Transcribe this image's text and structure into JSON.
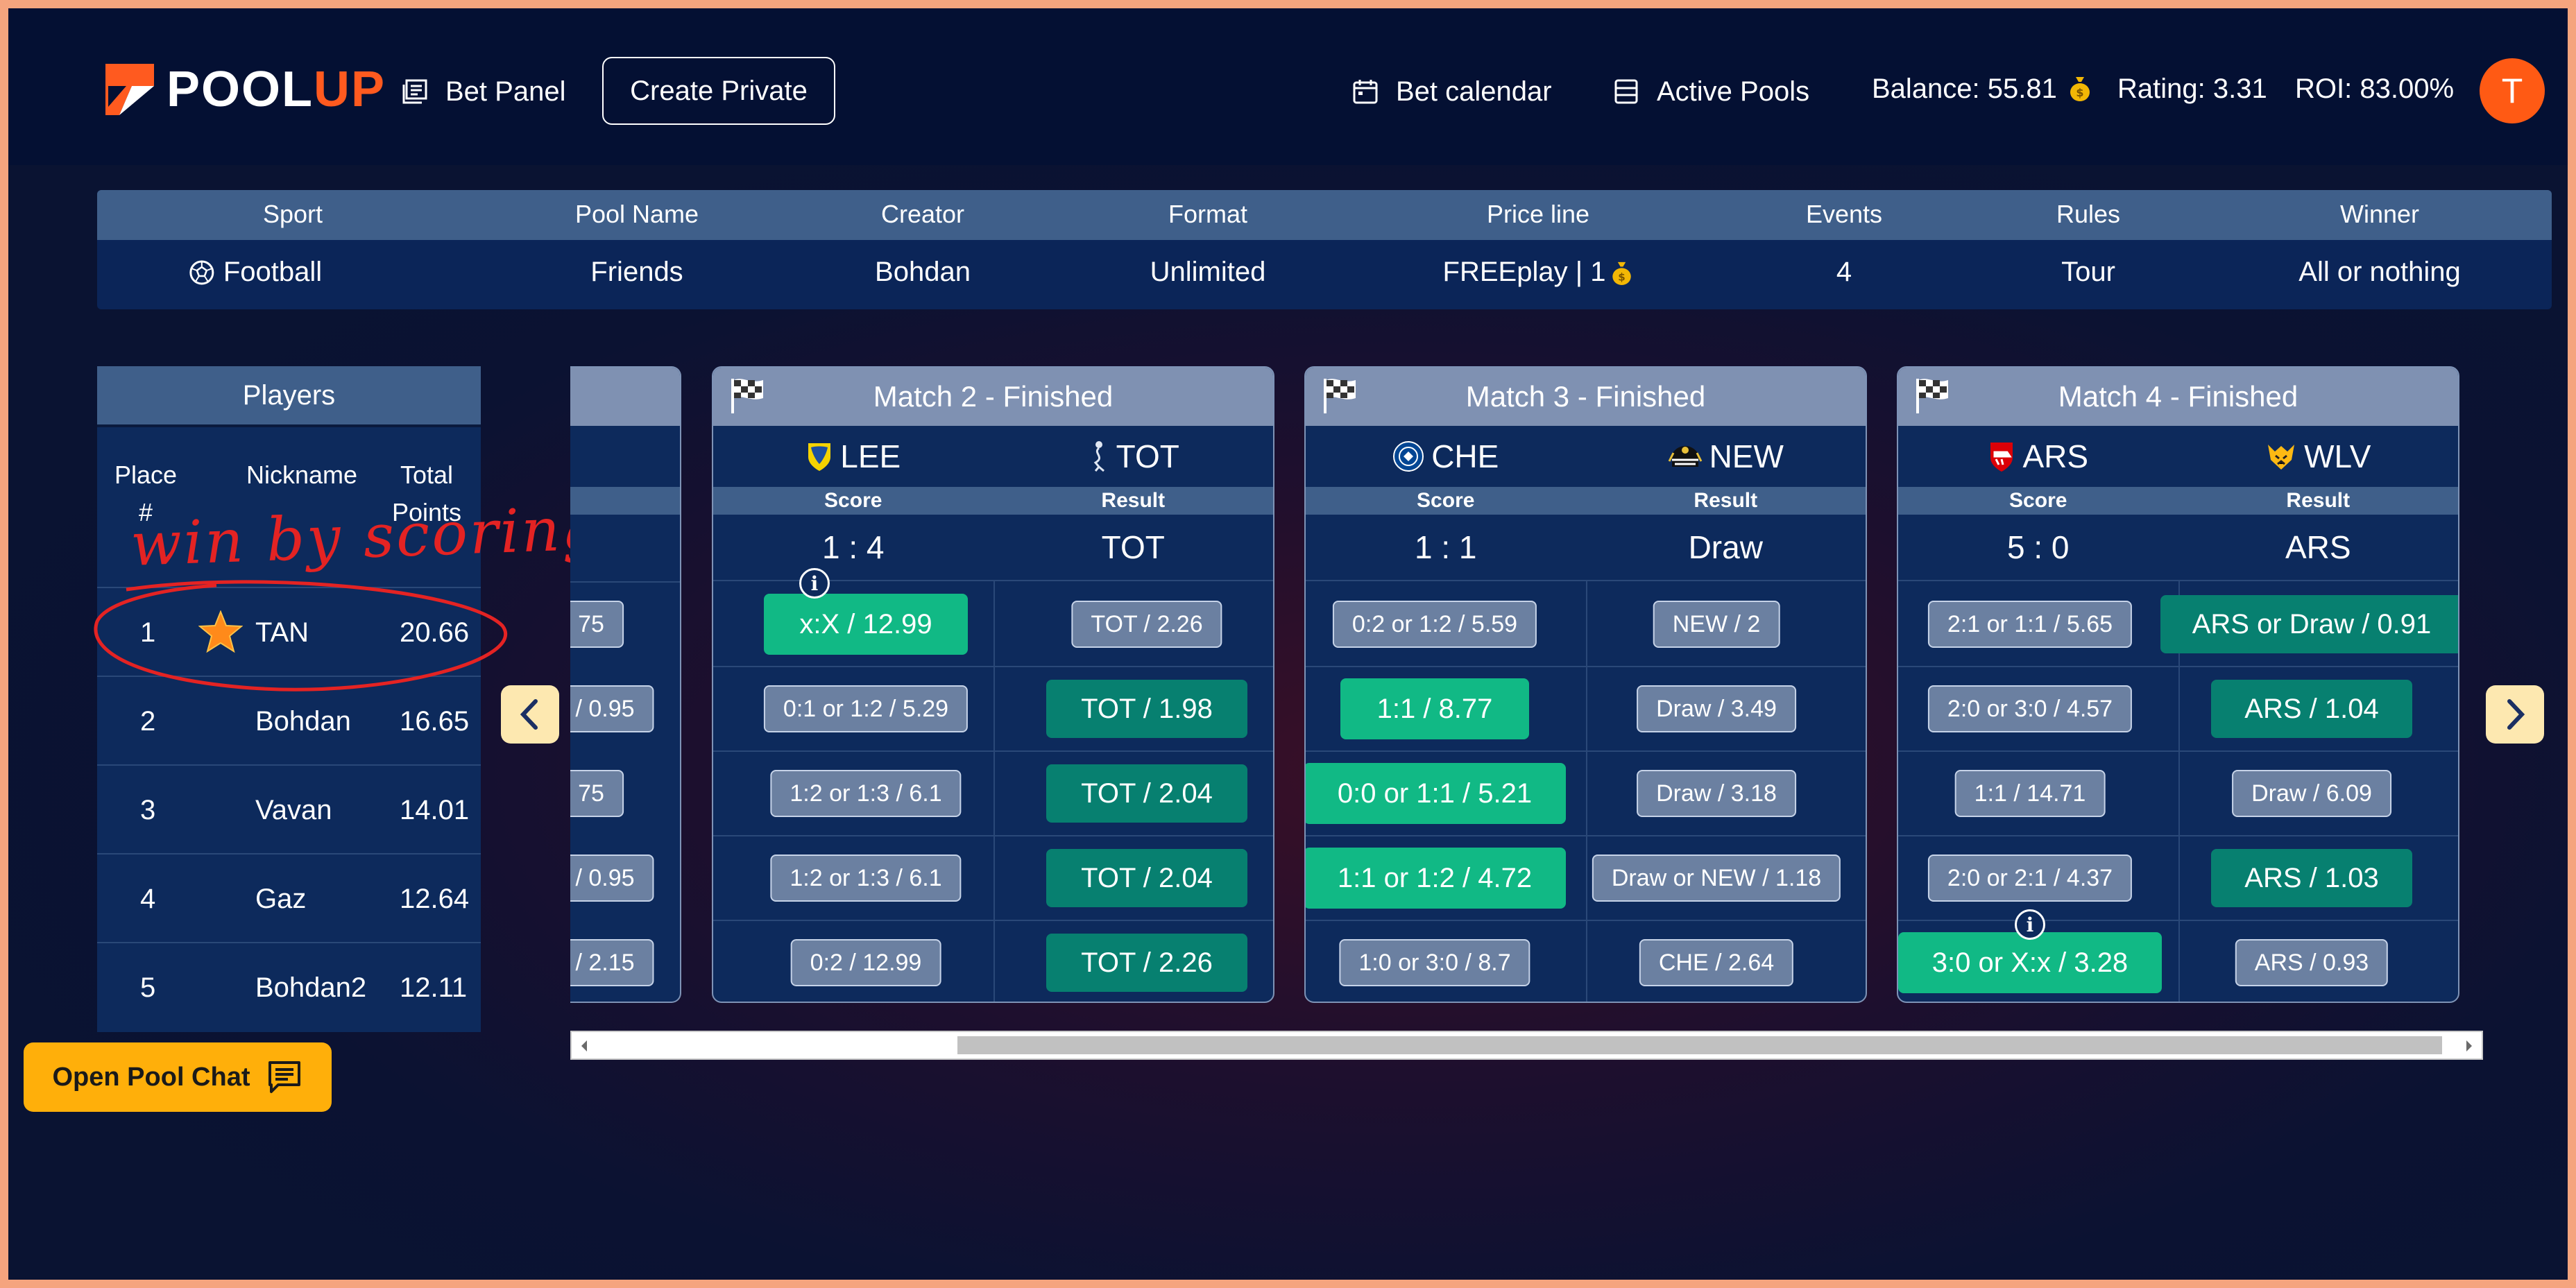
{
  "app": {
    "brand_left": "POOL",
    "brand_right": "UP"
  },
  "nav": {
    "bet_panel": "Bet Panel",
    "create_private": "Create Private",
    "bet_calendar": "Bet calendar",
    "active_pools": "Active Pools"
  },
  "stats": {
    "balance": "Balance: 55.81",
    "rating": "Rating: 3.31",
    "roi": "ROI: 83.00%"
  },
  "user": {
    "avatar_initial": "T"
  },
  "pool": {
    "headers": [
      "Sport",
      "Pool Name",
      "Creator",
      "Format",
      "Price line",
      "Events",
      "Rules",
      "Winner"
    ],
    "values": [
      "Football",
      "Friends",
      "Bohdan",
      "Unlimited",
      "FREEplay | 1",
      "4",
      "Tour",
      "All or nothing"
    ]
  },
  "players": {
    "title": "Players",
    "col_place": "Place #",
    "col_nickname": "Nickname",
    "col_points": "Total Points",
    "rows": [
      {
        "place": "1",
        "nickname": "TAN",
        "points": "20.66"
      },
      {
        "place": "2",
        "nickname": "Bohdan",
        "points": "16.65"
      },
      {
        "place": "3",
        "nickname": "Vavan",
        "points": "14.01"
      },
      {
        "place": "4",
        "nickname": "Gaz",
        "points": "12.64"
      },
      {
        "place": "5",
        "nickname": "Bohdan2",
        "points": "12.11"
      }
    ]
  },
  "annotation": {
    "text": "win by scoring"
  },
  "partial_match": {
    "bets": [
      "75",
      "/ 0.95",
      "75",
      "/ 0.95",
      "/ 2.15"
    ]
  },
  "matches": [
    {
      "title": "Match 2 - Finished",
      "home": "LEE",
      "away": "TOT",
      "score_label": "Score",
      "result_label": "Result",
      "score": "1 : 4",
      "result": "TOT",
      "left": [
        "x:X / 12.99",
        "0:1 or 1:2 / 5.29",
        "1:2 or 1:3 / 6.1",
        "1:2 or 1:3 / 6.1",
        "0:2 / 12.99"
      ],
      "right": [
        "TOT / 2.26",
        "TOT / 1.98",
        "TOT / 2.04",
        "TOT / 2.04",
        "TOT / 2.26"
      ]
    },
    {
      "title": "Match 3 - Finished",
      "home": "CHE",
      "away": "NEW",
      "score_label": "Score",
      "result_label": "Result",
      "score": "1 : 1",
      "result": "Draw",
      "left": [
        "0:2 or 1:2 / 5.59",
        "1:1 / 8.77",
        "0:0 or 1:1 / 5.21",
        "1:1 or 1:2 / 4.72",
        "1:0 or 3:0 / 8.7"
      ],
      "right": [
        "NEW / 2",
        "Draw / 3.49",
        "Draw / 3.18",
        "Draw or NEW / 1.18",
        "CHE / 2.64"
      ]
    },
    {
      "title": "Match 4 - Finished",
      "home": "ARS",
      "away": "WLV",
      "score_label": "Score",
      "result_label": "Result",
      "score": "5 : 0",
      "result": "ARS",
      "left": [
        "2:1 or 1:1 / 5.65",
        "2:0 or 3:0 / 4.57",
        "1:1 / 14.71",
        "2:0 or 2:1 / 4.37",
        "3:0 or X:x / 3.28"
      ],
      "right": [
        "ARS or Draw / 0.91",
        "ARS / 1.04",
        "Draw / 6.09",
        "ARS / 1.03",
        "ARS / 0.93"
      ]
    }
  ],
  "chat": {
    "label": "Open Pool Chat"
  },
  "colors": {
    "accent": "#ff5a14",
    "win_green": "#11b985",
    "win_teal": "#078070",
    "chat_yellow": "#ffaf0a",
    "annotation_red": "#e42323"
  }
}
